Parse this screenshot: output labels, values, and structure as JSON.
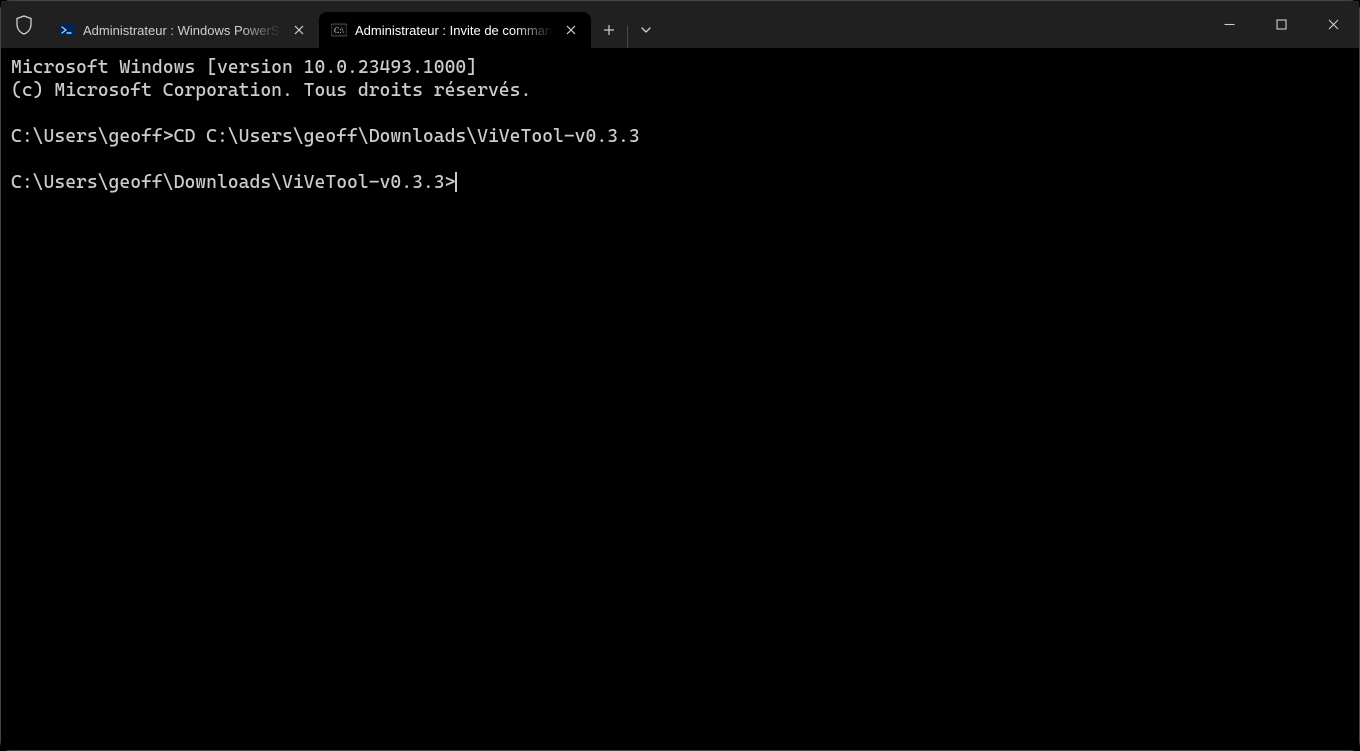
{
  "titlebar": {
    "tabs": [
      {
        "title": "Administrateur : Windows PowerShell",
        "active": false,
        "icon": "powershell-icon"
      },
      {
        "title": "Administrateur : Invite de commandes",
        "active": true,
        "icon": "cmd-icon"
      }
    ],
    "new_tab_label": "+",
    "dropdown_label": "⌄"
  },
  "terminal": {
    "lines": [
      "Microsoft Windows [version 10.0.23493.1000]",
      "(c) Microsoft Corporation. Tous droits réservés.",
      "",
      "C:\\Users\\geoff>CD C:\\Users\\geoff\\Downloads\\ViVeTool-v0.3.3",
      "",
      "C:\\Users\\geoff\\Downloads\\ViVeTool-v0.3.3>"
    ]
  }
}
